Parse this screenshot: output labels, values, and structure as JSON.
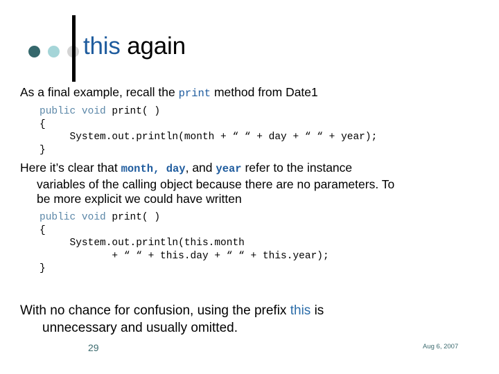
{
  "slide": {
    "title": {
      "keyword": "this",
      "rest": " again"
    },
    "decor": {
      "dot_colors": [
        "#35686c",
        "#a5d5d8",
        "#d4d4d4"
      ],
      "rule_color": "#000000"
    },
    "accent_colors": {
      "title_keyword": "#1f5c9e",
      "code_keyword": "#5b87a8",
      "inline_code": "#1f5c9e",
      "footer": "#3b6a6e"
    },
    "paragraphs": {
      "lead": {
        "before": "As a final example, recall the ",
        "code": "print",
        "after": " method from Date1"
      },
      "middle": {
        "line1_before": "Here it’s clear that ",
        "line1_code1": "month, day",
        "line1_between": ", and ",
        "line1_code2": "year",
        "line1_after": " refer to the instance",
        "line2": "variables of the calling object because there are no parameters.  To",
        "line3": "be more explicit we could have written"
      },
      "closing": {
        "line1_before": "With no chance for confusion, using the prefix ",
        "line1_code": "this",
        "line1_after": " is",
        "line2": "unnecessary and usually omitted."
      }
    },
    "code_blocks": [
      {
        "name": "print-method-implicit",
        "lines": [
          {
            "keyword": "public void ",
            "rest": "print( )"
          },
          {
            "keyword": "",
            "rest": "{"
          },
          {
            "keyword": "",
            "rest": "     System.out.println(month + “ “ + day + “ “ + year);"
          },
          {
            "keyword": "",
            "rest": "}"
          }
        ]
      },
      {
        "name": "print-method-explicit-this",
        "lines": [
          {
            "keyword": "public void ",
            "rest": "print( )"
          },
          {
            "keyword": "",
            "rest": "{"
          },
          {
            "keyword": "",
            "rest": "     System.out.println(this.month"
          },
          {
            "keyword": "",
            "rest": "            + “ “ + this.day + “ “ + this.year);"
          },
          {
            "keyword": "",
            "rest": "}"
          }
        ]
      }
    ],
    "footer": {
      "page_number": "29",
      "date": "Aug 6, 2007"
    }
  }
}
